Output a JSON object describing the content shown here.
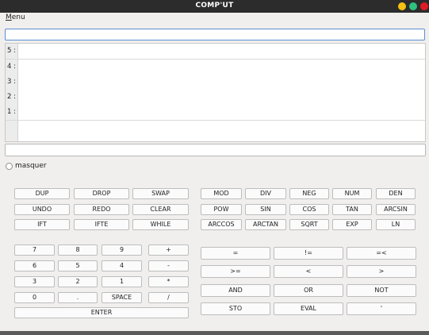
{
  "window": {
    "title": "COMP'UT"
  },
  "titlebar_colors": {
    "minimize": "#f5c211",
    "maximize": "#2ec27e",
    "close": "#e01b24"
  },
  "menu": {
    "label_first": "M",
    "label_rest": "enu"
  },
  "command_input": {
    "value": ""
  },
  "stack": [
    {
      "label": "5 :",
      "value": ""
    },
    {
      "label": "4 :",
      "value": ""
    },
    {
      "label": "3 :",
      "value": ""
    },
    {
      "label": "2 :",
      "value": ""
    },
    {
      "label": "1 :",
      "value": ""
    }
  ],
  "status_line": {
    "value": ""
  },
  "toggle": {
    "label": "masquer",
    "checked": false
  },
  "keypad": {
    "row1": [
      "DUP",
      "DROP",
      "SWAP"
    ],
    "row2": [
      "UNDO",
      "REDO",
      "CLEAR"
    ],
    "row3": [
      "IFT",
      "IFTE",
      "WHILE"
    ],
    "digits": [
      "7",
      "8",
      "9",
      "+",
      "6",
      "5",
      "4",
      "-",
      "3",
      "2",
      "1",
      "*",
      "0",
      ".",
      "SPACE",
      "/"
    ],
    "enter": "ENTER"
  },
  "functions": {
    "row1": [
      "MOD",
      "DIV",
      "NEG",
      "NUM",
      "DEN"
    ],
    "row2": [
      "POW",
      "SIN",
      "COS",
      "TAN",
      "ARCSIN"
    ],
    "row3": [
      "ARCCOS",
      "ARCTAN",
      "SQRT",
      "EXP",
      "LN"
    ]
  },
  "operators": {
    "row1": [
      "=",
      "!=",
      "=<"
    ],
    "row2": [
      ">=",
      "<",
      ">"
    ],
    "row3": [
      "AND",
      "OR",
      "NOT"
    ],
    "row4": [
      "STO",
      "EVAL",
      "'"
    ]
  }
}
